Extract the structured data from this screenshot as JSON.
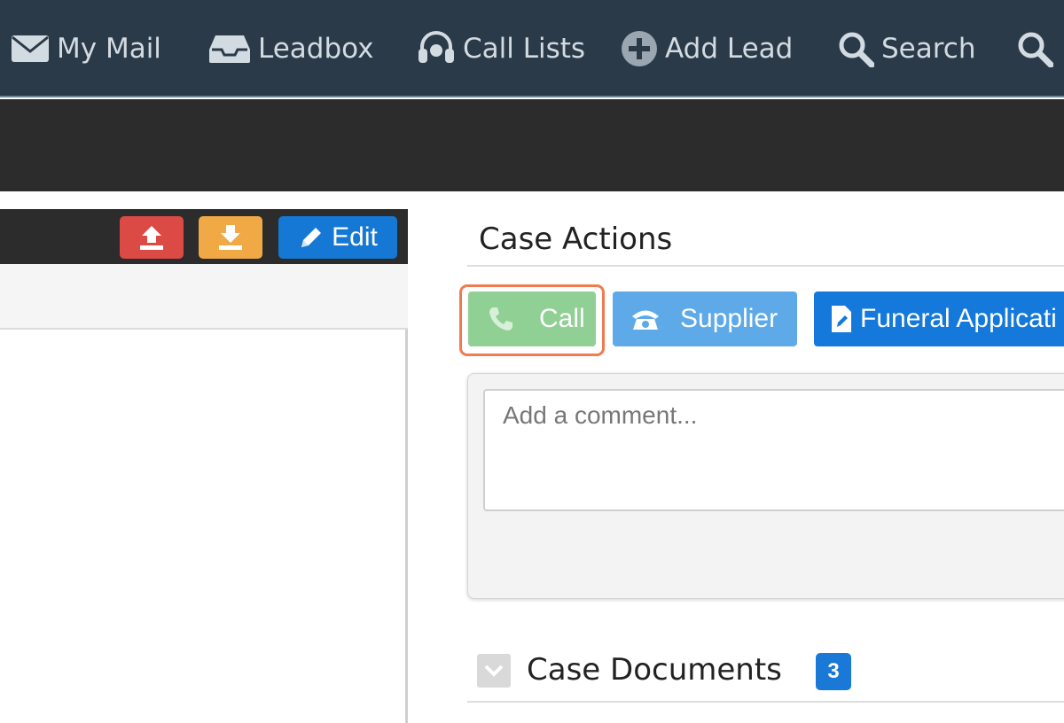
{
  "nav": {
    "items": [
      {
        "label": "My Mail",
        "icon": "envelope-icon"
      },
      {
        "label": "Leadbox",
        "icon": "inbox-tray-icon"
      },
      {
        "label": "Call Lists",
        "icon": "headset-icon"
      },
      {
        "label": "Add Lead",
        "icon": "plus-circle-icon"
      },
      {
        "label": "Search",
        "icon": "search-icon"
      },
      {
        "label": "",
        "icon": "search-icon"
      }
    ]
  },
  "record_panel": {
    "upload_icon": "upload-icon",
    "download_icon": "download-icon",
    "edit_label": "Edit"
  },
  "case_actions": {
    "title": "Case Actions",
    "buttons": [
      {
        "label": "Call",
        "icon": "phone-icon"
      },
      {
        "label": "Supplier",
        "icon": "rotary-phone-icon"
      },
      {
        "label": "Funeral Applicati",
        "icon": "document-edit-icon"
      }
    ],
    "comment_placeholder": "Add a comment..."
  },
  "case_documents": {
    "title": "Case Documents",
    "count": "3"
  },
  "colors": {
    "nav_bg": "#2b3a48",
    "call_button": "#90d094",
    "supplier_button": "#5eaae8",
    "funeral_button": "#1479db",
    "focus_outline": "#ef7b4e",
    "upload_button": "#db4a45",
    "download_button": "#f0a944",
    "edit_button": "#1478d4"
  }
}
